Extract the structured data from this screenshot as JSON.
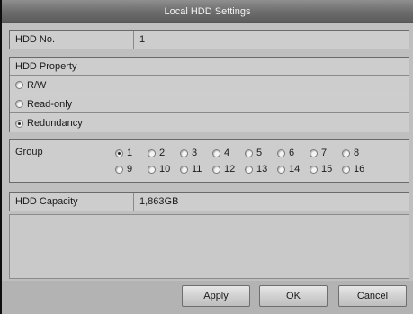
{
  "dialog": {
    "title": "Local HDD Settings"
  },
  "hdd_no": {
    "label": "HDD No.",
    "value": "1"
  },
  "hdd_property": {
    "header": "HDD Property",
    "options": [
      "R/W",
      "Read-only",
      "Redundancy"
    ],
    "selected": "Redundancy"
  },
  "group": {
    "label": "Group",
    "options_row1": [
      "1",
      "2",
      "3",
      "4",
      "5",
      "6",
      "7",
      "8"
    ],
    "options_row2": [
      "9",
      "10",
      "11",
      "12",
      "13",
      "14",
      "15",
      "16"
    ],
    "selected": "1"
  },
  "hdd_capacity": {
    "label": "HDD Capacity",
    "value": "1,863GB"
  },
  "buttons": {
    "apply": "Apply",
    "ok": "OK",
    "cancel": "Cancel"
  }
}
